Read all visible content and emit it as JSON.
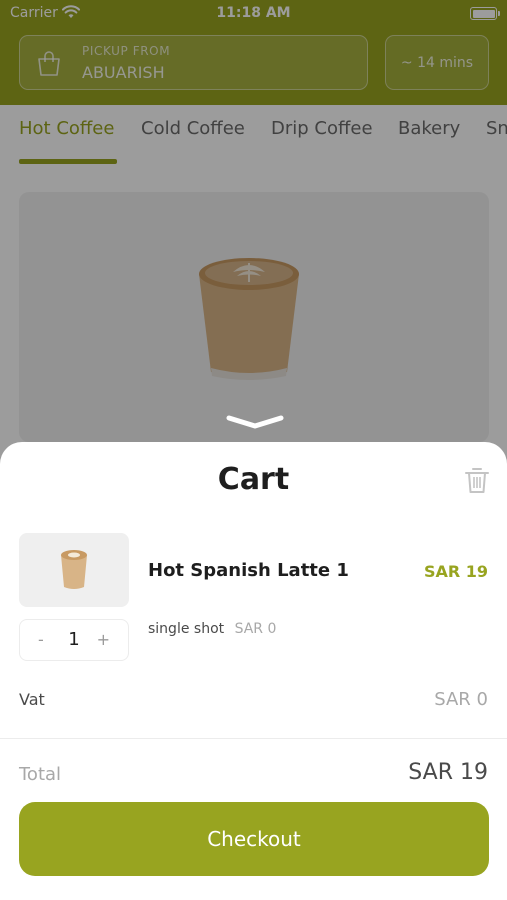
{
  "status_bar": {
    "carrier": "Carrier",
    "time": "11:18 AM"
  },
  "header": {
    "pickup_label": "PICKUP FROM",
    "pickup_location": "ABUARISH",
    "eta": "~ 14 mins"
  },
  "categories": {
    "tabs": [
      "Hot Coffee",
      "Cold Coffee",
      "Drip Coffee",
      "Bakery",
      "Sn"
    ],
    "active": "Hot Coffee"
  },
  "cart": {
    "title": "Cart",
    "items": [
      {
        "name": "Hot Spanish Latte 1",
        "price": "SAR 19",
        "quantity": "1",
        "option": "single shot",
        "option_price": "SAR 0"
      }
    ],
    "stepper": {
      "minus": "-",
      "plus": "+"
    },
    "vat_label": "Vat",
    "vat_value": "SAR 0",
    "total_label": "Total",
    "total_value": "SAR 19",
    "checkout_label": "Checkout"
  },
  "colors": {
    "accent": "#98a420",
    "overlay": "rgba(0,0,0,0.39)"
  },
  "icons": [
    "wifi-icon",
    "battery-icon",
    "shopping-bag-icon",
    "chevron-down-icon",
    "trash-icon",
    "coffee-cup-image"
  ]
}
